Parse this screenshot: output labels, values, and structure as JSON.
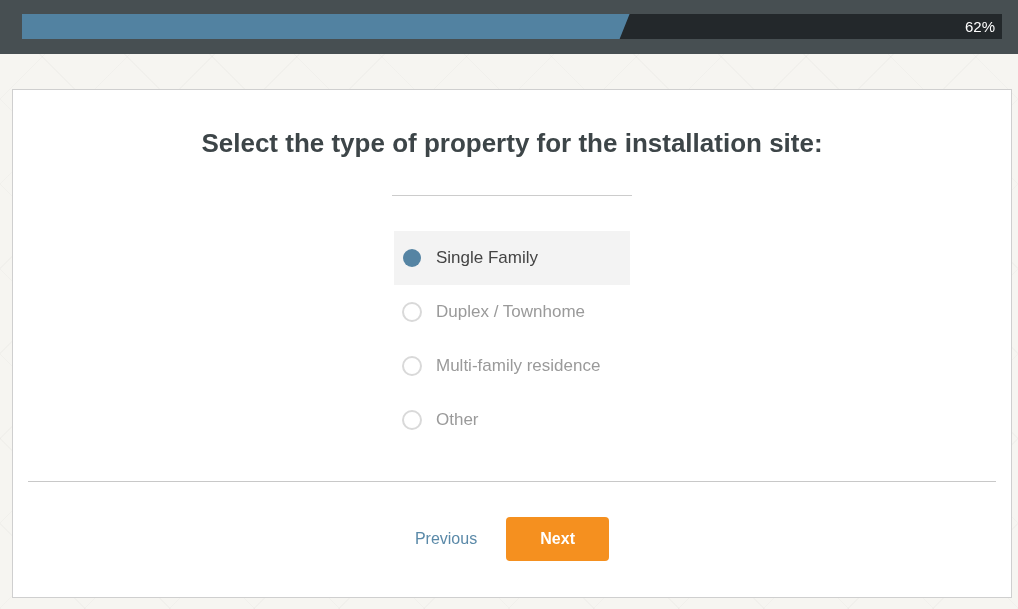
{
  "progress": {
    "level": 0.62,
    "reading": "62%"
  },
  "question": {
    "title": "Select the type of property for the installation site:",
    "options": [
      {
        "label": "Single Family",
        "selected": true
      },
      {
        "label": "Duplex / Townhome",
        "selected": false
      },
      {
        "label": "Multi-family residence",
        "selected": false
      },
      {
        "label": "Other",
        "selected": false
      }
    ]
  },
  "navigation": {
    "previous": "Previous",
    "next": "Next"
  }
}
